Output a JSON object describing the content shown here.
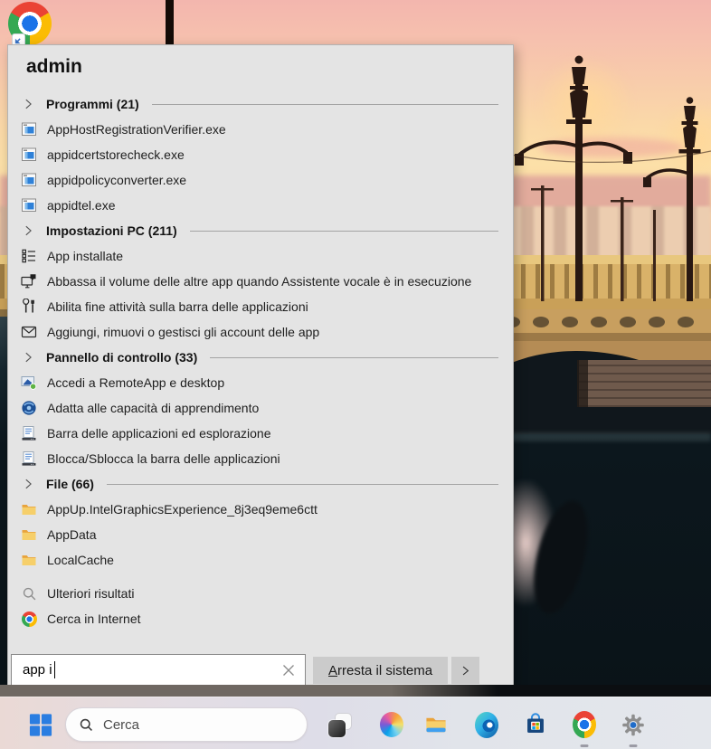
{
  "colors": {
    "menu_bg": "#e4e4e4",
    "menu_button_bg": "#cbcbcb",
    "accent_blue": "#2a7de1",
    "folder_yellow": "#f7cf6b",
    "taskbar_bg_left": "#ead9d5",
    "taskbar_bg_right": "#e4e7ec",
    "water_dark": "#0a1318",
    "sky_pink": "#f3b6ae",
    "sky_gold": "#fce0a8"
  },
  "desktop": {
    "shortcut_icon": "chrome"
  },
  "menu": {
    "title": "admin",
    "sections": [
      {
        "label": "Programmi (21)",
        "items": [
          {
            "icon": "exe-window",
            "label": "AppHostRegistrationVerifier.exe"
          },
          {
            "icon": "exe-window",
            "label": "appidcertstorecheck.exe"
          },
          {
            "icon": "exe-window",
            "label": "appidpolicyconverter.exe"
          },
          {
            "icon": "exe-window",
            "label": "appidtel.exe"
          }
        ]
      },
      {
        "label": "Impostazioni PC (211)",
        "items": [
          {
            "icon": "installed-apps",
            "label": "App installate"
          },
          {
            "icon": "narrator-monitor",
            "label": "Abbassa il volume delle altre app quando Assistente vocale è in esecuzione"
          },
          {
            "icon": "tools",
            "label": "Abilita fine attività sulla barra delle applicazioni"
          },
          {
            "icon": "mail",
            "label": "Aggiungi, rimuovi o gestisci gli account delle app"
          }
        ]
      },
      {
        "label": "Pannello di controllo (33)",
        "items": [
          {
            "icon": "remoteapp",
            "label": "Accedi a RemoteApp e desktop"
          },
          {
            "icon": "ease-of-access",
            "label": "Adatta alle capacità di apprendimento"
          },
          {
            "icon": "taskbar-window",
            "label": "Barra delle applicazioni ed esplorazione"
          },
          {
            "icon": "taskbar-window",
            "label": "Blocca/Sblocca la barra delle applicazioni"
          }
        ]
      },
      {
        "label": "File (66)",
        "items": [
          {
            "icon": "folder",
            "label": "AppUp.IntelGraphicsExperience_8j3eq9eme6ctt"
          },
          {
            "icon": "folder",
            "label": "AppData"
          },
          {
            "icon": "folder",
            "label": "LocalCache"
          }
        ]
      }
    ],
    "footer_items": [
      {
        "icon": "search",
        "label": "Ulteriori risultati"
      },
      {
        "icon": "chrome",
        "label": "Cerca in Internet"
      }
    ],
    "search": {
      "value": "app i"
    },
    "shutdown": {
      "mnemonic": "A",
      "rest": "rresta il sistema"
    }
  },
  "taskbar": {
    "search_label": "Cerca",
    "items": [
      {
        "icon": "start",
        "running": false
      },
      {
        "icon": "task-view",
        "running": false
      },
      {
        "icon": "copilot",
        "running": false
      },
      {
        "icon": "file-explorer",
        "running": false
      },
      {
        "icon": "edge",
        "running": false
      },
      {
        "icon": "store",
        "running": false
      },
      {
        "icon": "chrome",
        "running": true
      },
      {
        "icon": "settings",
        "running": true
      }
    ]
  }
}
